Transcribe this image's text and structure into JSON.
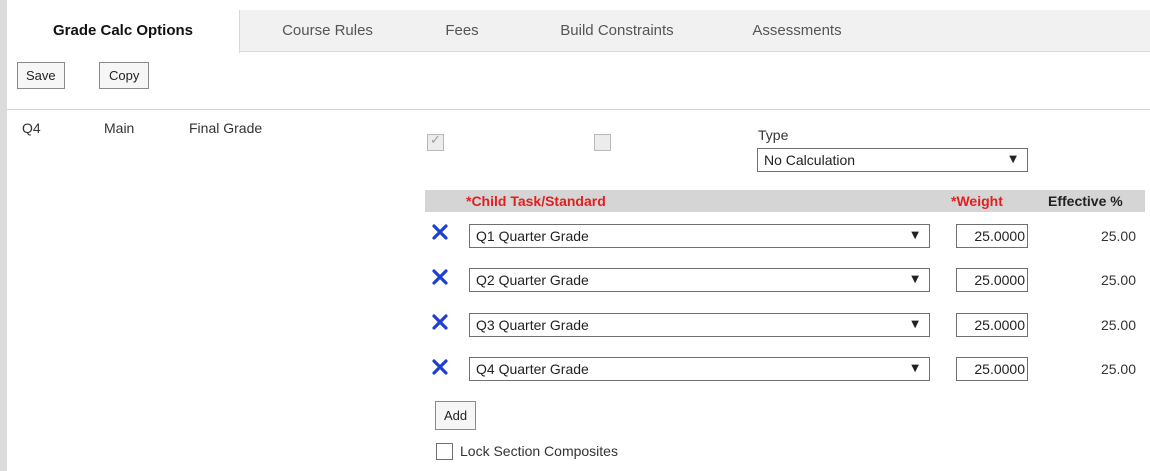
{
  "tabs": [
    {
      "label": "Grade Calc Options",
      "active": true
    },
    {
      "label": "Course Rules",
      "active": false
    },
    {
      "label": "Fees",
      "active": false
    },
    {
      "label": "Build Constraints",
      "active": false
    },
    {
      "label": "Assessments",
      "active": false
    }
  ],
  "toolbar": {
    "save_label": "Save",
    "copy_label": "Copy"
  },
  "task": {
    "term": "Q4",
    "group": "Main",
    "name": "Final Grade",
    "checkbox1_checked": true,
    "checkbox2_checked": false
  },
  "type_field": {
    "label": "Type",
    "value": "No Calculation"
  },
  "grid": {
    "headers": {
      "child": "*Child Task/Standard",
      "weight": "*Weight",
      "effective": "Effective %"
    },
    "rows": [
      {
        "task": "Q1 Quarter Grade",
        "weight": "25.0000",
        "effective": "25.00"
      },
      {
        "task": "Q2 Quarter Grade",
        "weight": "25.0000",
        "effective": "25.00"
      },
      {
        "task": "Q3 Quarter Grade",
        "weight": "25.0000",
        "effective": "25.00"
      },
      {
        "task": "Q4 Quarter Grade",
        "weight": "25.0000",
        "effective": "25.00"
      }
    ]
  },
  "add_label": "Add",
  "lock_label": "Lock Section Composites",
  "colors": {
    "required": "#e02020",
    "remove_icon": "#1f3fd1",
    "header_bg": "#d5d5d5"
  },
  "icons": {
    "remove": "close-icon",
    "dropdown": "chevron-down-icon"
  }
}
